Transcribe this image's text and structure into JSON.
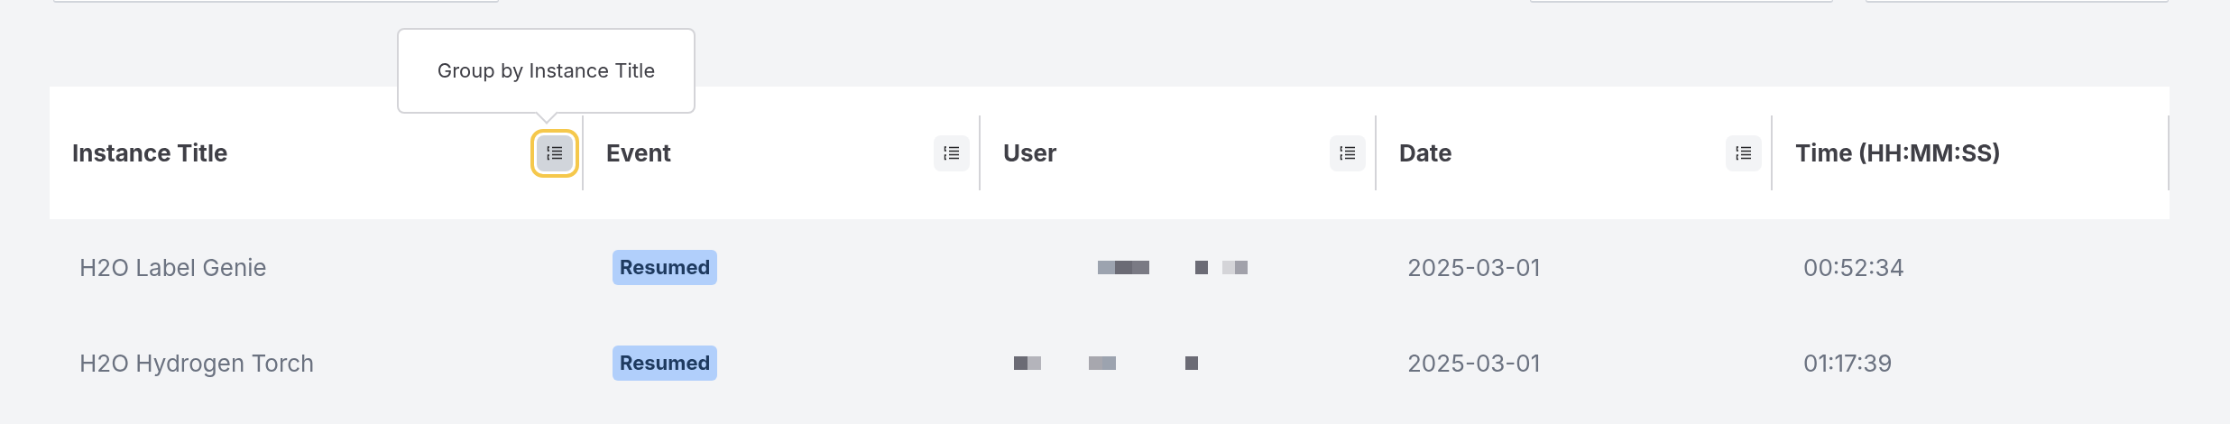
{
  "tooltip": {
    "text": "Group by Instance Title"
  },
  "table": {
    "columns": [
      {
        "label": "Instance Title",
        "kind": "groupable",
        "focused": true
      },
      {
        "label": "Event",
        "kind": "groupable",
        "focused": false
      },
      {
        "label": "User",
        "kind": "groupable",
        "focused": false
      },
      {
        "label": "Date",
        "kind": "groupable",
        "focused": false
      },
      {
        "label": "Time (HH:MM:SS)",
        "kind": "plain"
      }
    ],
    "rows": [
      {
        "instance_title": "H2O Label Genie",
        "event": "Resumed",
        "date": "2025-03-01",
        "time": "00:52:34"
      },
      {
        "instance_title": "H2O Hydrogen Torch",
        "event": "Resumed",
        "date": "2025-03-01",
        "time": "01:17:39"
      }
    ]
  }
}
